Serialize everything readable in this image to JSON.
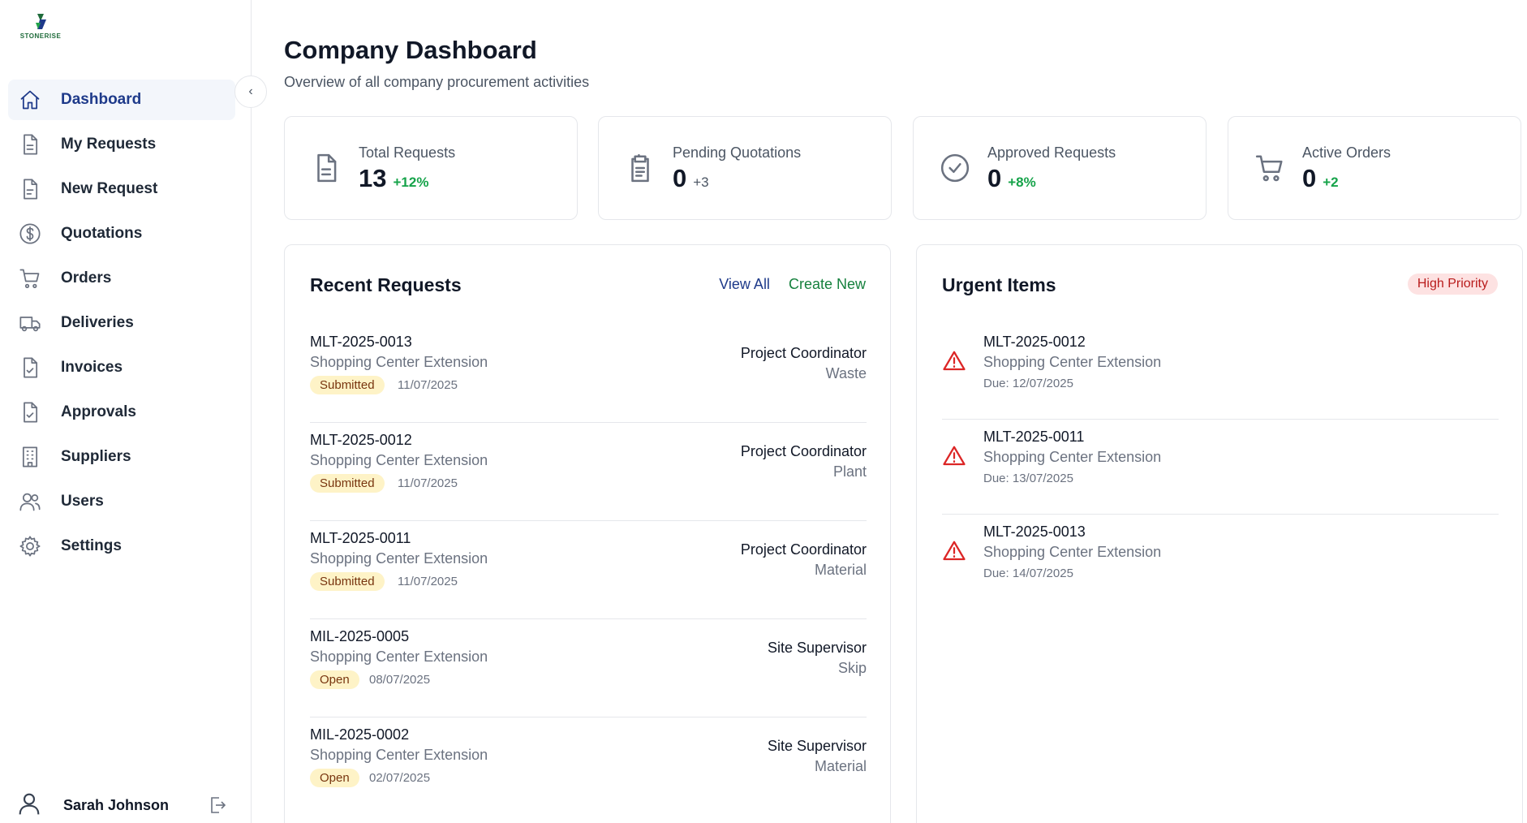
{
  "brand": {
    "name": "STONERISE",
    "primary": "#1e3a8a",
    "accent": "#15803d"
  },
  "sidebar": {
    "items": [
      {
        "label": "Dashboard",
        "icon": "home-icon",
        "active": true
      },
      {
        "label": "My Requests",
        "icon": "file-icon"
      },
      {
        "label": "New Request",
        "icon": "file-text-icon"
      },
      {
        "label": "Quotations",
        "icon": "dollar-circle-icon"
      },
      {
        "label": "Orders",
        "icon": "cart-icon"
      },
      {
        "label": "Deliveries",
        "icon": "truck-icon"
      },
      {
        "label": "Invoices",
        "icon": "file-check-icon"
      },
      {
        "label": "Approvals",
        "icon": "file-check-icon"
      },
      {
        "label": "Suppliers",
        "icon": "building-icon"
      },
      {
        "label": "Users",
        "icon": "users-icon"
      },
      {
        "label": "Settings",
        "icon": "gear-icon"
      }
    ],
    "user": {
      "name": "Sarah Johnson"
    }
  },
  "header": {
    "title": "Company Dashboard",
    "subtitle": "Overview of all company procurement activities"
  },
  "stats": [
    {
      "label": "Total Requests",
      "value": "13",
      "delta": "+12%",
      "icon": "file-icon"
    },
    {
      "label": "Pending Quotations",
      "value": "0",
      "delta": "+3",
      "icon": "clipboard-icon"
    },
    {
      "label": "Approved Requests",
      "value": "0",
      "delta": "+8%",
      "icon": "check-circle-icon"
    },
    {
      "label": "Active Orders",
      "value": "0",
      "delta": "+2",
      "icon": "cart-icon"
    }
  ],
  "recent": {
    "title": "Recent Requests",
    "view_all": "View All",
    "create_new": "Create New",
    "rows": [
      {
        "id": "MLT-2025-0013",
        "project": "Shopping Center Extension",
        "status": "Submitted",
        "date": "11/07/2025",
        "role": "Project Coordinator",
        "category": "Waste"
      },
      {
        "id": "MLT-2025-0012",
        "project": "Shopping Center Extension",
        "status": "Submitted",
        "date": "11/07/2025",
        "role": "Project Coordinator",
        "category": "Plant"
      },
      {
        "id": "MLT-2025-0011",
        "project": "Shopping Center Extension",
        "status": "Submitted",
        "date": "11/07/2025",
        "role": "Project Coordinator",
        "category": "Material"
      },
      {
        "id": "MIL-2025-0005",
        "project": "Shopping Center Extension",
        "status": "Open",
        "date": "08/07/2025",
        "role": "Site Supervisor",
        "category": "Skip"
      },
      {
        "id": "MIL-2025-0002",
        "project": "Shopping Center Extension",
        "status": "Open",
        "date": "02/07/2025",
        "role": "Site Supervisor",
        "category": "Material"
      }
    ]
  },
  "urgent": {
    "title": "Urgent Items",
    "badge": "High Priority",
    "rows": [
      {
        "id": "MLT-2025-0012",
        "project": "Shopping Center Extension",
        "due": "Due: 12/07/2025"
      },
      {
        "id": "MLT-2025-0011",
        "project": "Shopping Center Extension",
        "due": "Due: 13/07/2025"
      },
      {
        "id": "MLT-2025-0013",
        "project": "Shopping Center Extension",
        "due": "Due: 14/07/2025"
      }
    ]
  }
}
